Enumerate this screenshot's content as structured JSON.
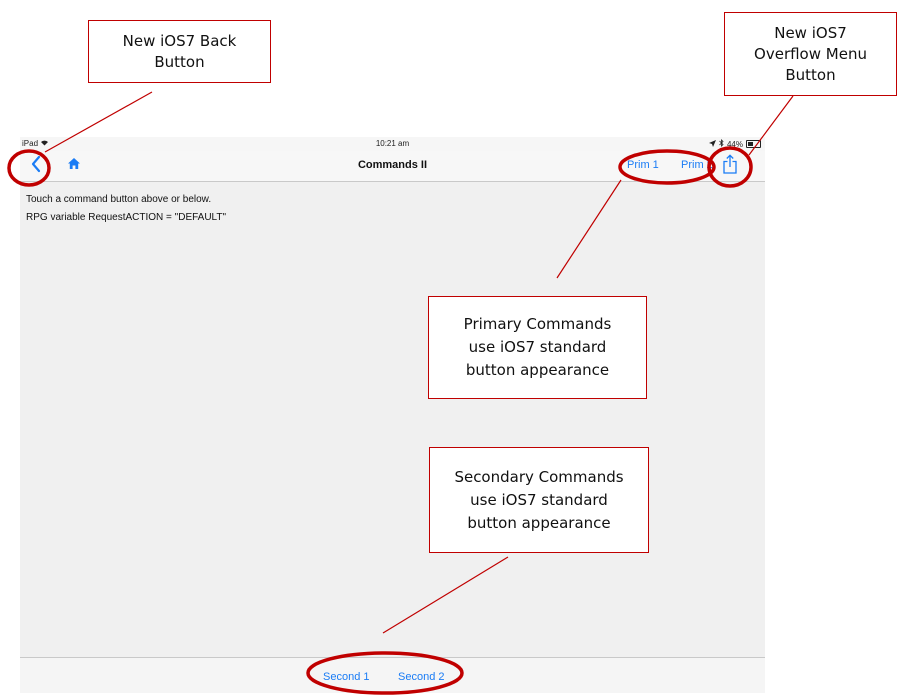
{
  "status_bar": {
    "device": "iPad",
    "time": "10:21 am",
    "battery": "44%"
  },
  "nav_bar": {
    "title": "Commands II",
    "primary_commands": [
      "Prim 1",
      "Prim 2"
    ]
  },
  "content": {
    "lines": [
      "Touch a command button above or below.",
      "RPG variable RequestACTION = \"DEFAULT\""
    ]
  },
  "toolbar": {
    "secondary_commands": [
      "Second 1",
      "Second 2"
    ]
  },
  "callouts": {
    "back_button": "New iOS7 Back\nButton",
    "overflow_button": "New iOS7\nOverflow Menu\nButton",
    "primary_commands": "Primary Commands\nuse iOS7 standard\nbutton appearance",
    "secondary_commands": "Secondary Commands\nuse iOS7 standard\nbutton appearance"
  },
  "colors": {
    "accent": "#1a7cf5",
    "annotation": "#c00000"
  },
  "icons": {
    "back": "chevron-left-icon",
    "home": "home-icon",
    "overflow": "share-icon",
    "wifi": "wifi-icon",
    "battery": "battery-icon",
    "location": "location-icon",
    "bluetooth": "bluetooth-icon"
  }
}
